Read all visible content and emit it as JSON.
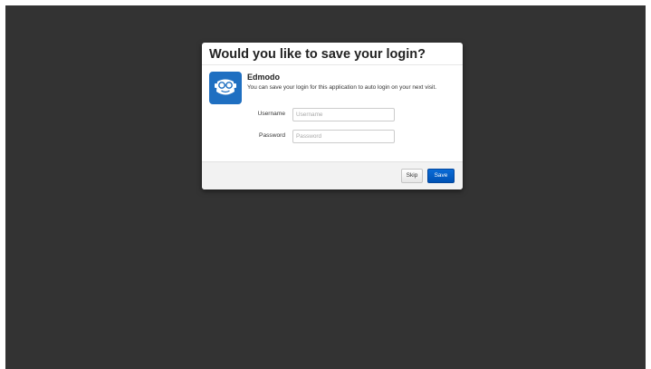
{
  "dialog": {
    "title": "Would you like to save your login?",
    "app_name": "Edmodo",
    "description": "You can save your login for this application to auto login on your next visit.",
    "app_icon": "edmodo-logo-icon"
  },
  "form": {
    "username_label": "Username",
    "username_placeholder": "Username",
    "password_label": "Password",
    "password_placeholder": "Password"
  },
  "buttons": {
    "skip_label": "Skip",
    "save_label": "Save"
  },
  "colors": {
    "backdrop": "#333333",
    "brand": "#1f6fc1",
    "primary_button": "#0a6bd6"
  }
}
